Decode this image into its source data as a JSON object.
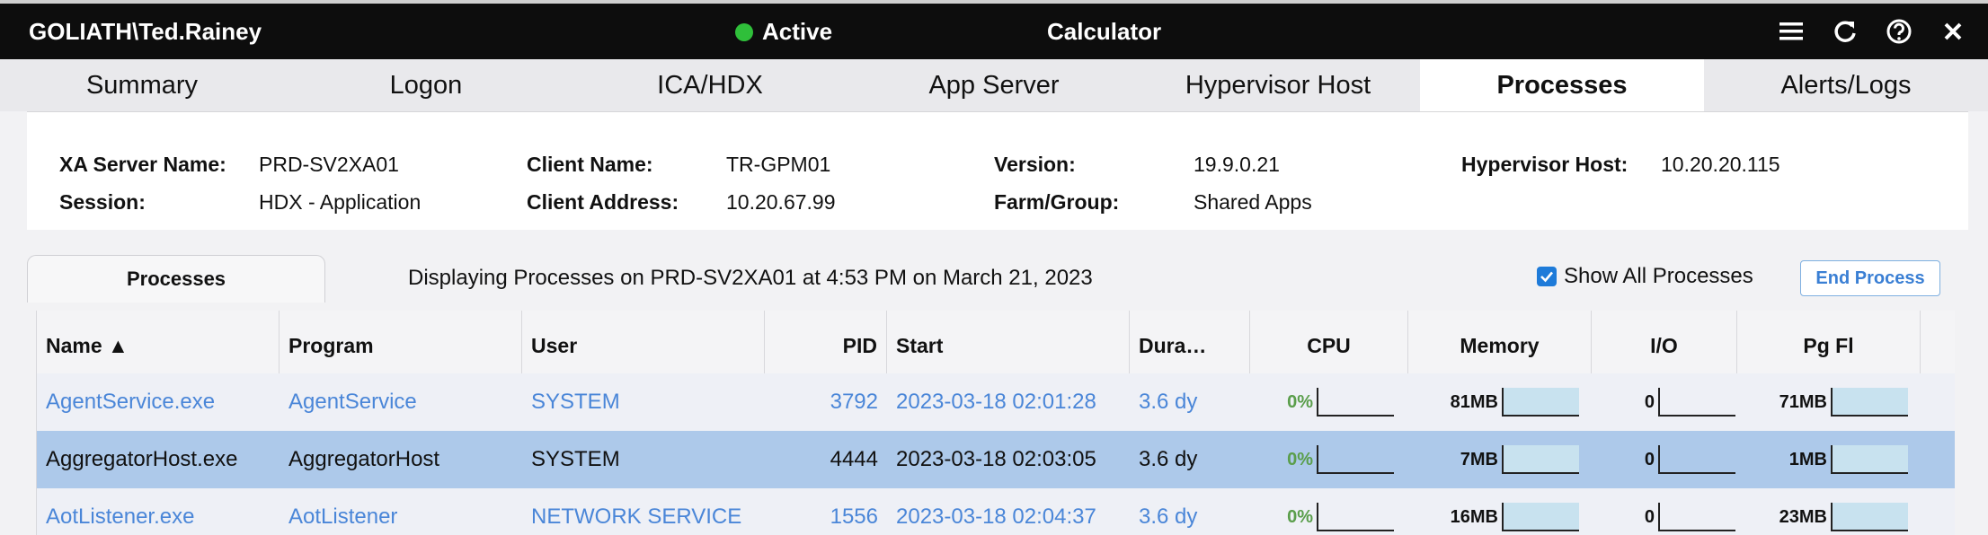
{
  "titlebar": {
    "user": "GOLIATH\\Ted.Rainey",
    "status": "Active",
    "app": "Calculator"
  },
  "icons": [
    "menu-icon",
    "refresh-icon",
    "help-icon",
    "close-icon"
  ],
  "tabs": [
    {
      "label": "Summary",
      "active": false
    },
    {
      "label": "Logon",
      "active": false
    },
    {
      "label": "ICA/HDX",
      "active": false
    },
    {
      "label": "App Server",
      "active": false
    },
    {
      "label": "Hypervisor Host",
      "active": false
    },
    {
      "label": "Processes",
      "active": true
    },
    {
      "label": "Alerts/Logs",
      "active": false
    }
  ],
  "info": {
    "xa_server_label": "XA Server Name:",
    "xa_server": "PRD-SV2XA01",
    "session_label": "Session:",
    "session": "HDX - Application",
    "client_name_label": "Client Name:",
    "client_name": "TR-GPM01",
    "client_address_label": "Client Address:",
    "client_address": "10.20.67.99",
    "version_label": "Version:",
    "version": "19.9.0.21",
    "farm_label": "Farm/Group:",
    "farm": "Shared Apps",
    "hypervisor_label": "Hypervisor Host:",
    "hypervisor": "10.20.20.115"
  },
  "processes_panel": {
    "tab_label": "Processes",
    "caption": "Displaying Processes on PRD-SV2XA01 at 4:53 PM on March 21, 2023",
    "show_all_label": "Show All Processes",
    "show_all_checked": true,
    "end_process_label": "End Process"
  },
  "columns": {
    "name": "Name ▲",
    "program": "Program",
    "user": "User",
    "pid": "PID",
    "start": "Start",
    "duration": "Dura…",
    "cpu": "CPU",
    "memory": "Memory",
    "io": "I/O",
    "pgfl": "Pg Fl"
  },
  "rows": [
    {
      "name": "AgentService.exe",
      "program": "AgentService",
      "user": "SYSTEM",
      "pid": "3792",
      "start": "2023-03-18 02:01:28",
      "duration": "3.6 dy",
      "cpu": "0%",
      "memory": "81MB",
      "io": "0",
      "pgfl": "71MB",
      "style": "blue"
    },
    {
      "name": "AggregatorHost.exe",
      "program": "AggregatorHost",
      "user": "SYSTEM",
      "pid": "4444",
      "start": "2023-03-18 02:03:05",
      "duration": "3.6 dy",
      "cpu": "0%",
      "memory": "7MB",
      "io": "0",
      "pgfl": "1MB",
      "style": "sel"
    },
    {
      "name": "AotListener.exe",
      "program": "AotListener",
      "user": "NETWORK SERVICE",
      "pid": "1556",
      "start": "2023-03-18 02:04:37",
      "duration": "3.6 dy",
      "cpu": "0%",
      "memory": "16MB",
      "io": "0",
      "pgfl": "23MB",
      "style": "blue"
    }
  ],
  "colors": {
    "titlebar_bg": "#0d0d0d",
    "status_dot": "#2fbf3a",
    "link_text": "#4a86d8",
    "selected_row": "#adc9ea",
    "cpu_text": "#5a9e4b",
    "meter_fill": "#c8e2ef"
  }
}
